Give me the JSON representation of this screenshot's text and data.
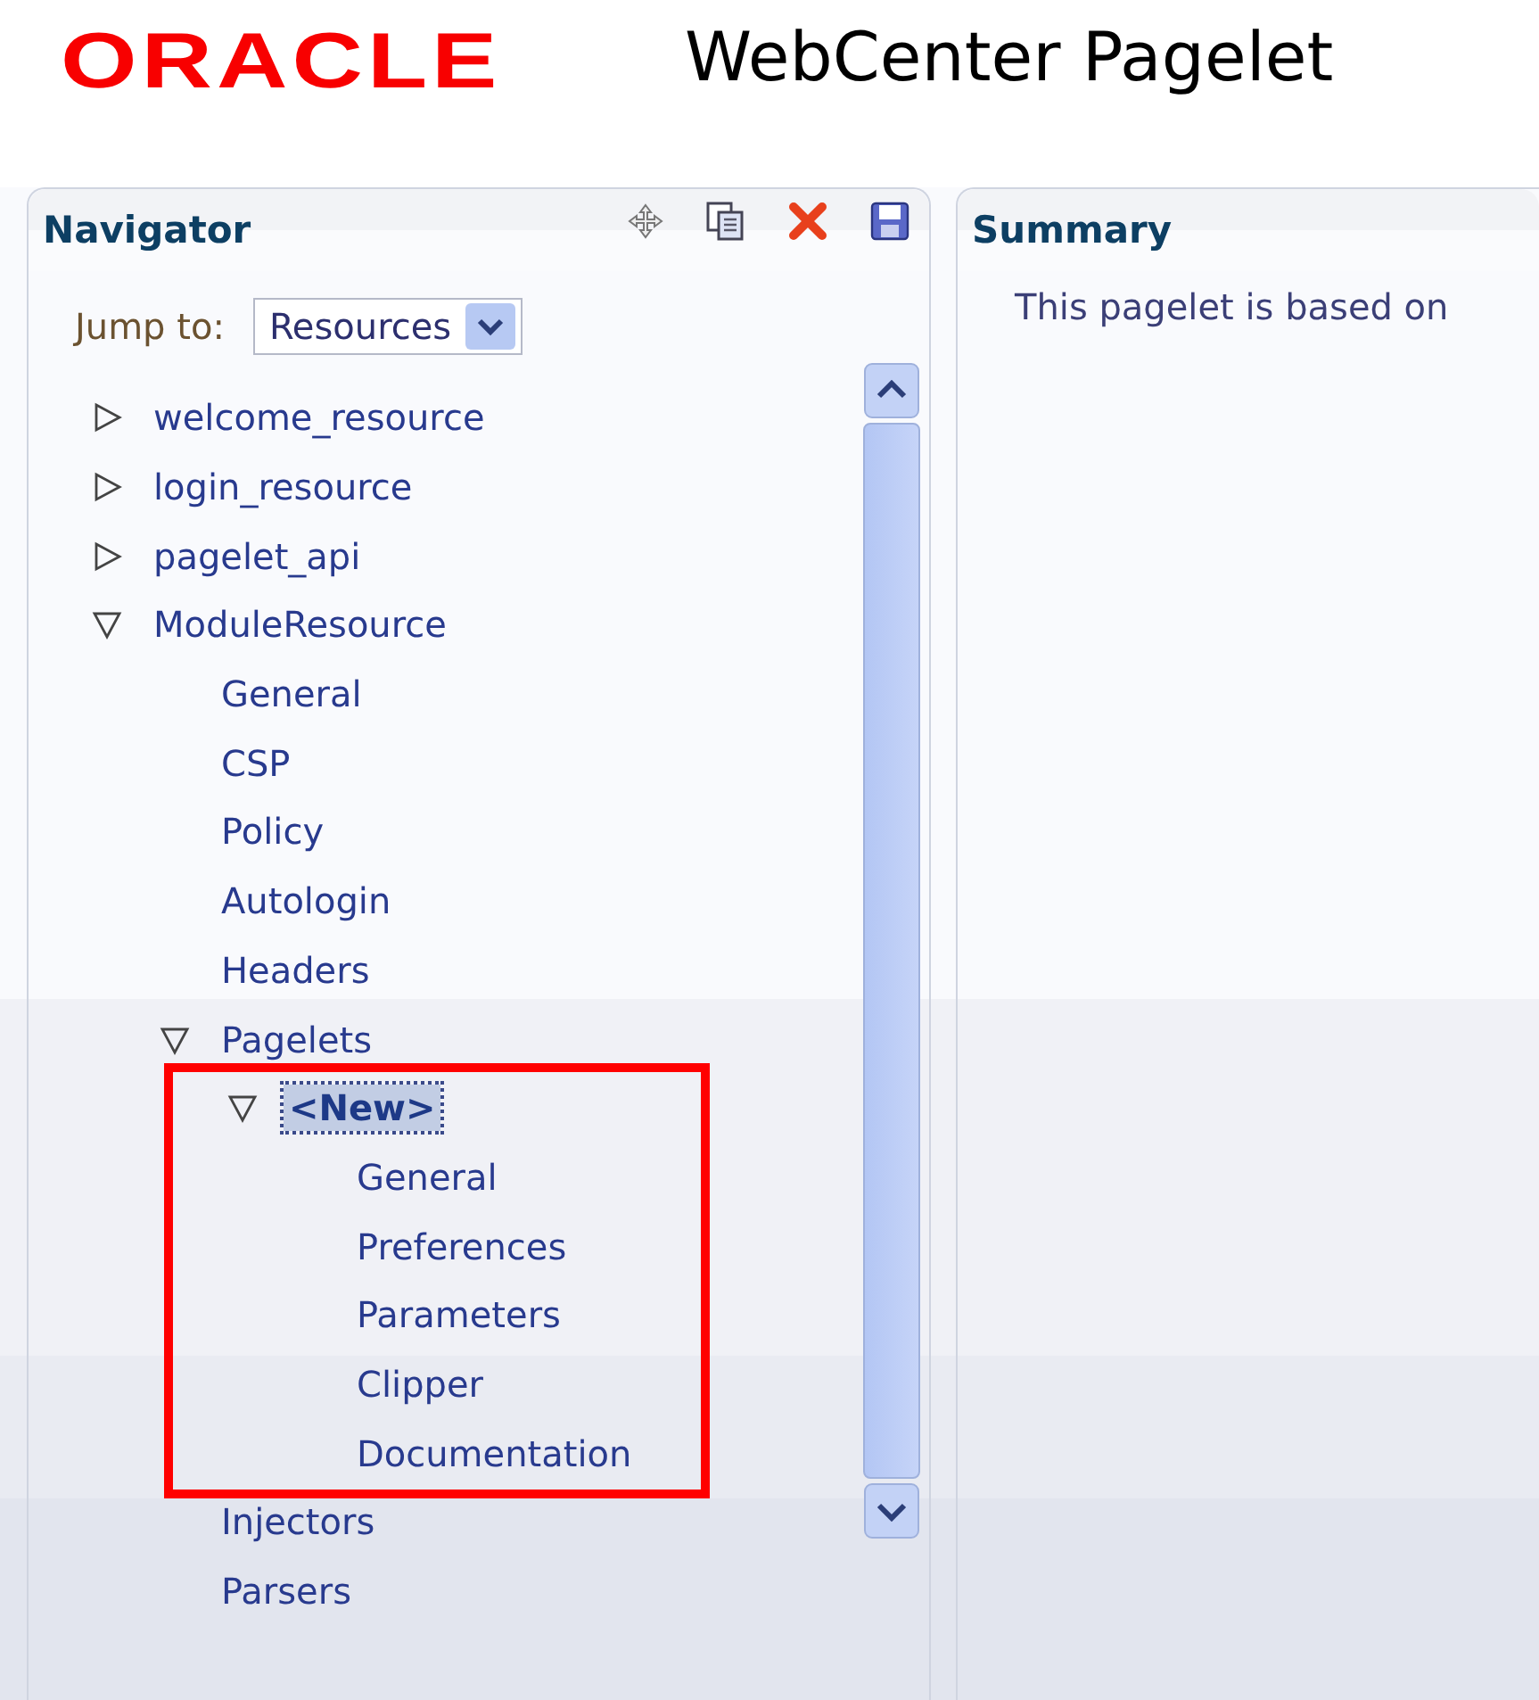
{
  "header": {
    "logo": "ORACLE",
    "title": "WebCenter Pagelet"
  },
  "navigator": {
    "title": "Navigator",
    "jump_to": {
      "label": "Jump to:",
      "value": "Resources"
    },
    "tree": [
      {
        "label": "welcome_resource",
        "expanded": false,
        "selected": false
      },
      {
        "label": "login_resource",
        "expanded": false,
        "selected": false
      },
      {
        "label": "pagelet_api",
        "expanded": false,
        "selected": false
      },
      {
        "label": "ModuleResource",
        "expanded": true,
        "selected": false,
        "children": [
          {
            "label": "General",
            "selected": false
          },
          {
            "label": "CSP",
            "selected": false
          },
          {
            "label": "Policy",
            "selected": false
          },
          {
            "label": "Autologin",
            "selected": false
          },
          {
            "label": "Headers",
            "selected": false
          },
          {
            "label": "Pagelets",
            "expanded": true,
            "selected": false,
            "children": [
              {
                "label": "<New>",
                "expanded": true,
                "selected": true,
                "children": [
                  {
                    "label": "General",
                    "selected": false
                  },
                  {
                    "label": "Preferences",
                    "selected": false
                  },
                  {
                    "label": "Parameters",
                    "selected": false
                  },
                  {
                    "label": "Clipper",
                    "selected": false
                  },
                  {
                    "label": "Documentation",
                    "selected": false
                  }
                ]
              }
            ]
          },
          {
            "label": "Injectors",
            "selected": false
          },
          {
            "label": "Parsers",
            "selected": false
          }
        ]
      }
    ]
  },
  "summary": {
    "title": "Summary",
    "text": "This pagelet is based on"
  }
}
